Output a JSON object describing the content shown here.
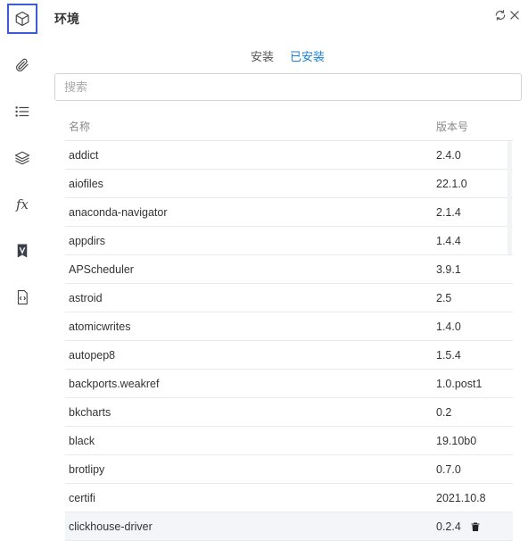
{
  "app": {
    "title": "环境"
  },
  "sidebar": {
    "items": [
      {
        "icon": "package-icon",
        "active": true
      },
      {
        "icon": "paperclip-icon",
        "active": false
      },
      {
        "icon": "list-icon",
        "active": false
      },
      {
        "icon": "layers-icon",
        "active": false
      },
      {
        "icon": "function-icon",
        "label": "fx",
        "active": false
      },
      {
        "icon": "variable-icon",
        "active": false
      },
      {
        "icon": "code-file-icon",
        "active": false
      }
    ]
  },
  "tabs": [
    {
      "label": "安装",
      "active": false
    },
    {
      "label": "已安装",
      "active": true
    }
  ],
  "search": {
    "placeholder": "搜索"
  },
  "table": {
    "headers": {
      "name": "名称",
      "version": "版本号"
    },
    "rows": [
      {
        "name": "addict",
        "version": "2.4.0"
      },
      {
        "name": "aiofiles",
        "version": "22.1.0"
      },
      {
        "name": "anaconda-navigator",
        "version": "2.1.4"
      },
      {
        "name": "appdirs",
        "version": "1.4.4"
      },
      {
        "name": "APScheduler",
        "version": "3.9.1"
      },
      {
        "name": "astroid",
        "version": "2.5"
      },
      {
        "name": "atomicwrites",
        "version": "1.4.0"
      },
      {
        "name": "autopep8",
        "version": "1.5.4"
      },
      {
        "name": "backports.weakref",
        "version": "1.0.post1"
      },
      {
        "name": "bkcharts",
        "version": "0.2"
      },
      {
        "name": "black",
        "version": "19.10b0"
      },
      {
        "name": "brotlipy",
        "version": "0.7.0"
      },
      {
        "name": "certifi",
        "version": "2021.10.8"
      },
      {
        "name": "clickhouse-driver",
        "version": "0.2.4",
        "hovered": true
      }
    ]
  },
  "colors": {
    "accent": "#1a7fd4",
    "active_border": "#3b5bdb"
  }
}
